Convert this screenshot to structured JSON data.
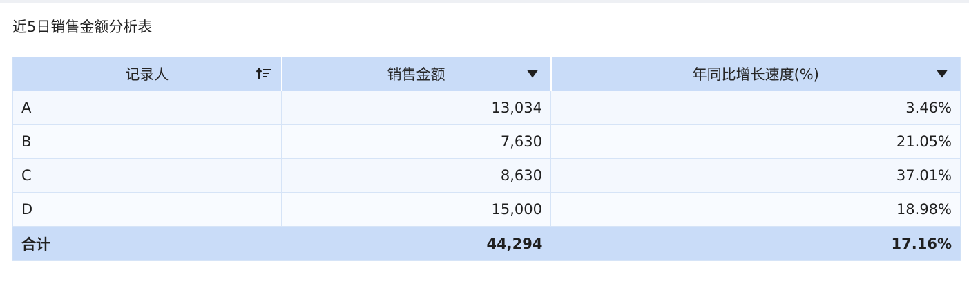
{
  "report": {
    "title": "近5日销售金额分析表"
  },
  "table": {
    "columns": [
      {
        "label": "记录人",
        "icon": "sort-ascending-icon"
      },
      {
        "label": "销售金额",
        "icon": "dropdown-triangle-icon"
      },
      {
        "label": "年同比增长速度(%)",
        "icon": "dropdown-triangle-icon"
      }
    ],
    "rows": [
      {
        "name": "A",
        "amount": "13,034",
        "growth": "3.46%"
      },
      {
        "name": "B",
        "amount": "7,630",
        "growth": "21.05%"
      },
      {
        "name": "C",
        "amount": "8,630",
        "growth": "37.01%"
      },
      {
        "name": "D",
        "amount": "15,000",
        "growth": "18.98%"
      }
    ],
    "total": {
      "label": "合计",
      "amount": "44,294",
      "growth": "17.16%"
    }
  },
  "colors": {
    "header_bg": "#c9dcf8",
    "row_bg": "#f4f8fe",
    "border": "#d6e4f7"
  }
}
